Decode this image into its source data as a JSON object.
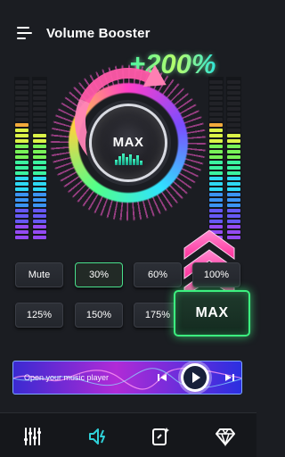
{
  "header": {
    "title": "Volume Booster",
    "boost_level": "+200%"
  },
  "dial": {
    "label": "MAX"
  },
  "presets": {
    "row1": [
      "Mute",
      "30%",
      "60%",
      "100%"
    ],
    "row2": [
      "125%",
      "150%",
      "175%"
    ],
    "selected": "30%",
    "max_label": "MAX"
  },
  "player": {
    "prompt": "Open your music player"
  },
  "bottom_nav": {
    "items": [
      "equalizer-icon",
      "volume-boost-icon",
      "theme-icon",
      "premium-diamond-icon"
    ],
    "active": "volume-boost-icon"
  },
  "colors": {
    "background": "#1b1d22",
    "accent_green": "#3cf07f",
    "accent_pink": "#ff3ec9",
    "active_nav": "#2fd0d8"
  }
}
